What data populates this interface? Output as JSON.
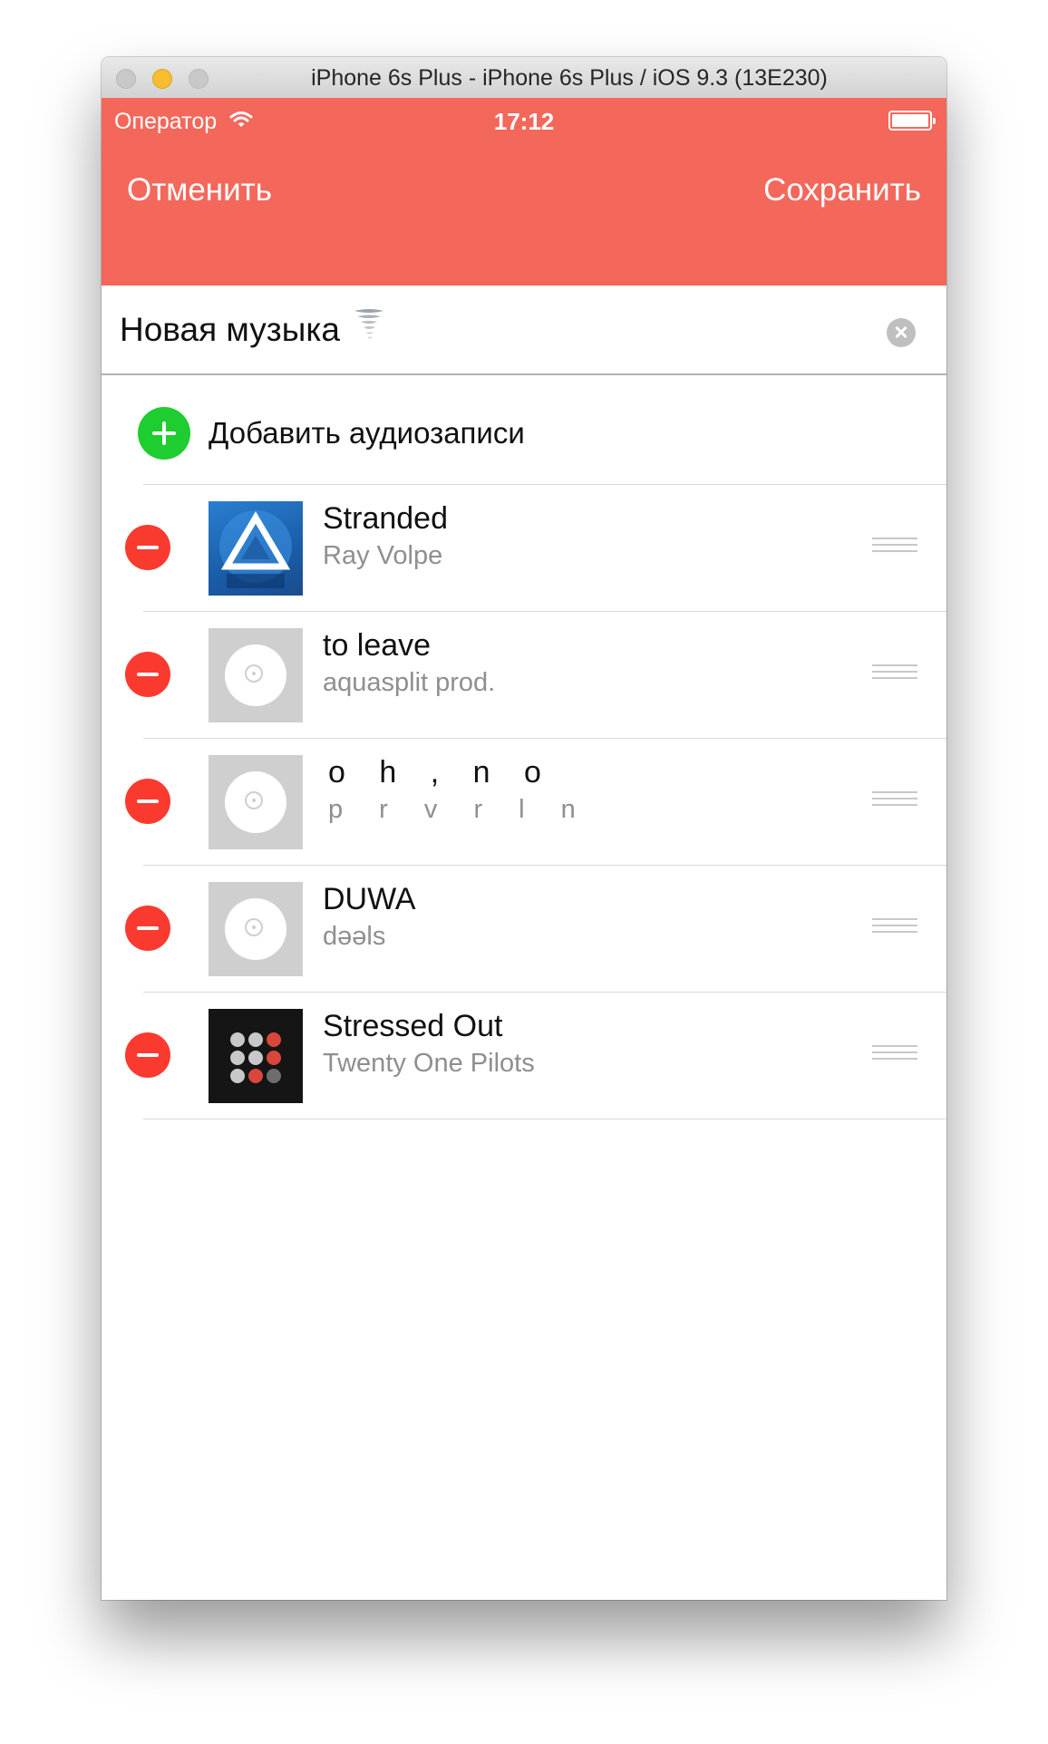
{
  "window": {
    "title": "iPhone 6s Plus - iPhone 6s Plus / iOS 9.3 (13E230)"
  },
  "status_bar": {
    "carrier": "Оператор",
    "time": "17:12"
  },
  "nav": {
    "cancel_label": "Отменить",
    "save_label": "Сохранить"
  },
  "playlist": {
    "name": "Новая музыка"
  },
  "add_row": {
    "label": "Добавить аудиозаписи"
  },
  "tracks": [
    {
      "title": "Stranded",
      "artist": "Ray Volpe",
      "cover": "catalyst-album-art"
    },
    {
      "title": "to leave",
      "artist": "aquasplit prod.",
      "cover": "placeholder-disc"
    },
    {
      "title": "o h , n o",
      "artist": "p r v r l n",
      "cover": "placeholder-disc"
    },
    {
      "title": "DUWA",
      "artist": "dəəls",
      "cover": "placeholder-disc"
    },
    {
      "title": "Stressed Out",
      "artist": "Twenty One Pilots",
      "cover": "blurryface-album-art"
    }
  ],
  "colors": {
    "nav": "#f4675b",
    "add": "#1ecd2f",
    "delete": "#fa3a2f"
  },
  "icons": [
    "wifi-icon",
    "battery-icon",
    "tornado-emoji-icon",
    "clear-icon",
    "add-icon",
    "delete-icon",
    "reorder-icon"
  ]
}
